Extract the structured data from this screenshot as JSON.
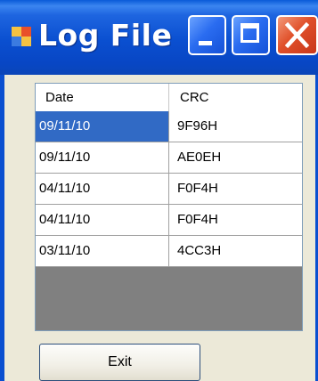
{
  "window": {
    "title": "Log File",
    "colors": {
      "titlebar": "#0a4fd0",
      "selection": "#316ac5",
      "body": "#ece9d8"
    }
  },
  "grid": {
    "columns": [
      "Date",
      "CRC"
    ],
    "rows": [
      {
        "date": "09/11/10",
        "crc": "9F96H",
        "selected": true
      },
      {
        "date": "09/11/10",
        "crc": "AE0EH"
      },
      {
        "date": "04/11/10",
        "crc": "F0F4H"
      },
      {
        "date": "04/11/10",
        "crc": "F0F4H"
      },
      {
        "date": "03/11/10",
        "crc": "4CC3H"
      }
    ]
  },
  "buttons": {
    "exit_label": "Exit"
  },
  "icons": [
    "app-icon",
    "minimize-icon",
    "maximize-icon",
    "close-icon"
  ]
}
